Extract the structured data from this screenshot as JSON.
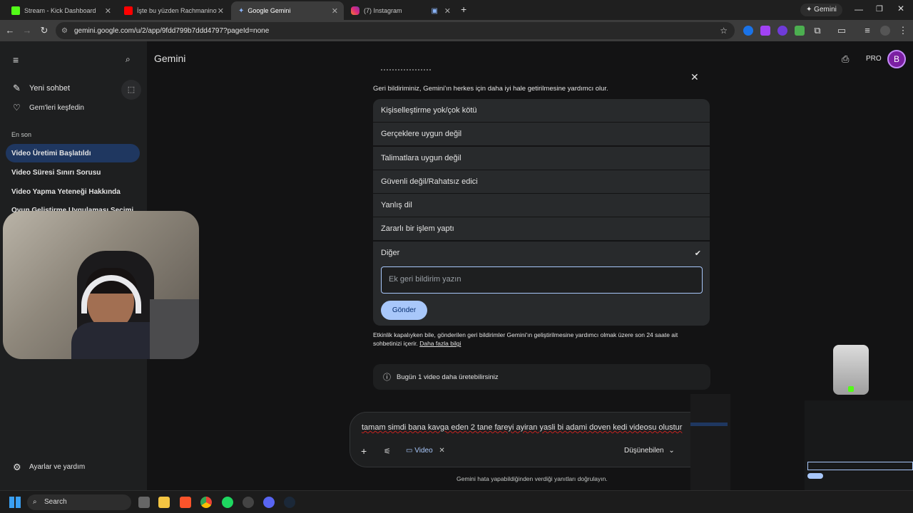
{
  "tabs": [
    {
      "title": "Stream - Kick Dashboard",
      "color": "#53fc18"
    },
    {
      "title": "İşte bu yüzden Rachmaninoff E",
      "color": "#ff0000"
    },
    {
      "title": "Google Gemini",
      "color": "#8ab4f8"
    },
    {
      "title": "(7) Instagram",
      "color": "#e1306c"
    }
  ],
  "browser": {
    "url": "gemini.google.com/u/2/app/9fdd799b7ddd4797?pageId=none",
    "gemini_button": "Gemini"
  },
  "sidebar": {
    "new_chat": "Yeni sohbet",
    "explore_gems": "Gem'leri keşfedin",
    "recent_heading": "En son",
    "recent": [
      "Video Üretimi Başlatıldı",
      "Video Süresi Sınırı Sorusu",
      "Video Yapma Yeteneği Hakkında",
      "Oyun Geliştirme Uygulaması Seçimi"
    ],
    "settings": "Ayarlar ve yardım"
  },
  "header": {
    "title": "Gemini",
    "pro_badge": "PRO",
    "avatar_letter": "B"
  },
  "feedback": {
    "subtitle": "Geri bildiriminiz, Gemini'ın herkes için daha iyi hale getirilmesine yardımcı olur.",
    "options": [
      "Kişiselleştirme yok/çok kötü",
      "Gerçeklere uygun değil",
      "Talimatlara uygun değil",
      "Güvenli değil/Rahatsız edici",
      "Yanlış dil",
      "Zararlı bir işlem yaptı",
      "Diğer"
    ],
    "selected": "Diğer",
    "textarea_placeholder": "Ek geri bildirim yazın",
    "submit": "Gönder",
    "disclaimer": "Etkinlik kapalıyken bile, gönderilen geri bildirimler Gemini'ın geliştirilmesine yardımcı olmak üzere son 24 saate ait sohbetinizi içerir.",
    "learn_more": "Daha fazla bilgi"
  },
  "info_banner": "Bugün 1 video daha üretebilirsiniz",
  "prompt": {
    "text": "tamam simdi bana kavga eden 2 tane fareyi ayiran yasli bi adami doven kedi videosu olustur",
    "tool_chip": "Video",
    "model": "Düşünebilen"
  },
  "footer_note": "Gemini hata yapabildiğinden verdiği yanıtları doğrulayın.",
  "taskbar": {
    "search": "Search"
  }
}
